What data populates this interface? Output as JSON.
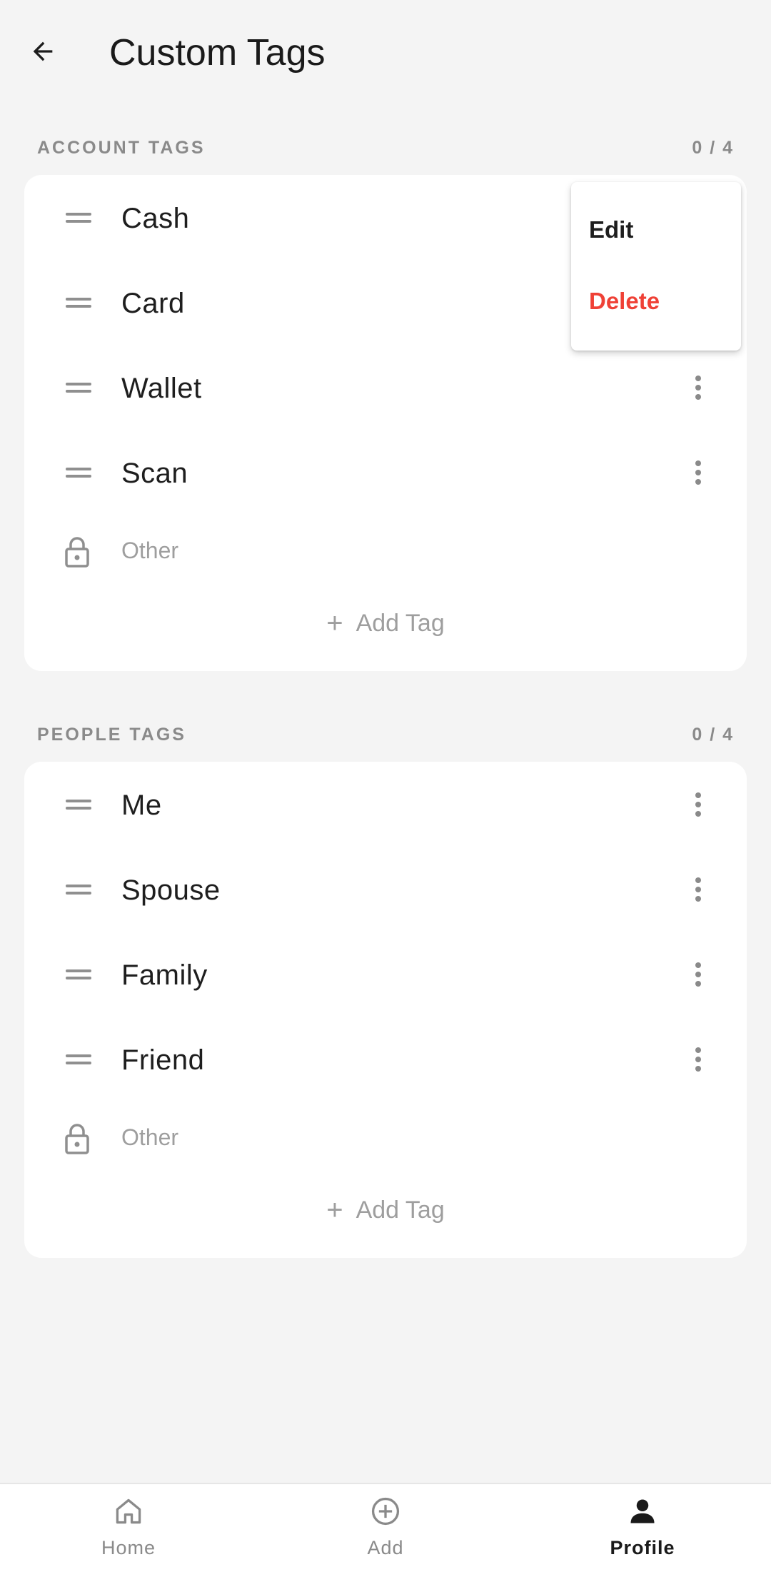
{
  "header": {
    "title": "Custom Tags"
  },
  "account_section": {
    "title": "ACCOUNT TAGS",
    "count": "0 / 4",
    "tags": [
      "Cash",
      "Card",
      "Wallet",
      "Scan"
    ],
    "locked_label": "Other",
    "add_label": "Add Tag",
    "add_symbol": "+"
  },
  "people_section": {
    "title": "PEOPLE TAGS",
    "count": "0 / 4",
    "tags": [
      "Me",
      "Spouse",
      "Family",
      "Friend"
    ],
    "locked_label": "Other",
    "add_label": "Add Tag",
    "add_symbol": "+"
  },
  "context_menu": {
    "edit": "Edit",
    "delete": "Delete",
    "delete_color": "#ef4136"
  },
  "bottom_nav": {
    "items": [
      {
        "label": "Home",
        "icon": "home-icon",
        "active": false
      },
      {
        "label": "Add",
        "icon": "add-circle-icon",
        "active": false
      },
      {
        "label": "Profile",
        "icon": "person-icon",
        "active": true
      }
    ],
    "active_color": "#1a1a1a",
    "inactive_color": "#8a8a8a"
  }
}
